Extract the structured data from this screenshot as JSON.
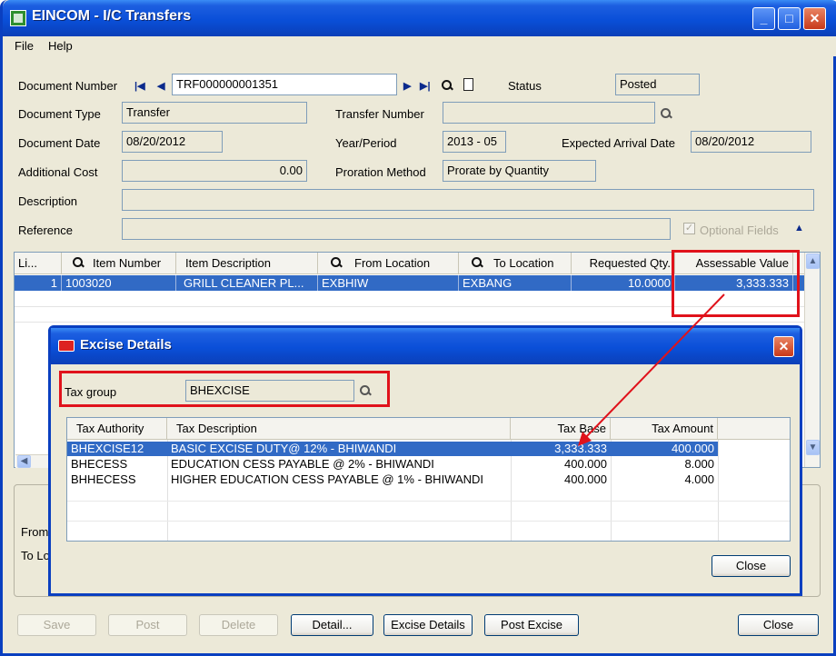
{
  "window": {
    "title": "EINCOM - I/C Transfers"
  },
  "menu": {
    "file": "File",
    "help": "Help"
  },
  "header": {
    "document_number_label": "Document Number",
    "document_number_value": "TRF000000001351",
    "status_label": "Status",
    "status_value": "Posted",
    "document_type_label": "Document Type",
    "document_type_value": "Transfer",
    "transfer_number_label": "Transfer Number",
    "transfer_number_value": "",
    "document_date_label": "Document Date",
    "document_date_value": "08/20/2012",
    "year_period_label": "Year/Period",
    "year_period_value": "2013 - 05",
    "expected_arrival_label": "Expected Arrival Date",
    "expected_arrival_value": "08/20/2012",
    "additional_cost_label": "Additional Cost",
    "additional_cost_value": "0.00",
    "proration_label": "Proration Method",
    "proration_value": "Prorate by Quantity",
    "description_label": "Description",
    "description_value": "",
    "reference_label": "Reference",
    "reference_value": "",
    "optional_fields_label": "Optional Fields"
  },
  "grid": {
    "columns": [
      "Li...",
      "Item Number",
      "Item Description",
      "From Location",
      "To Location",
      "Requested Qty.",
      "Assessable Value"
    ],
    "rows": [
      {
        "line": "1",
        "item_number": "1003020",
        "item_description": "GRILL CLEANER PL...",
        "from_location": "EXBHIW",
        "to_location": "EXBANG",
        "requested_qty": "10.0000",
        "assessable_value": "3,333.333"
      }
    ]
  },
  "lower_panel": {
    "from_label": "From",
    "to_label": "To Lo"
  },
  "buttons": {
    "save": "Save",
    "post": "Post",
    "delete": "Delete",
    "detail": "Detail...",
    "excise_details": "Excise Details",
    "post_excise": "Post Excise",
    "close": "Close"
  },
  "dialog": {
    "title": "Excise Details",
    "tax_group_label": "Tax group",
    "tax_group_value": "BHEXCISE",
    "columns": [
      "Tax Authority",
      "Tax Description",
      "Tax Base",
      "Tax Amount"
    ],
    "rows": [
      {
        "authority": "BHEXCISE12",
        "description": "BASIC EXCISE DUTY@ 12% - BHIWANDI",
        "base": "3,333.333",
        "amount": "400.000"
      },
      {
        "authority": "BHECESS",
        "description": "EDUCATION CESS PAYABLE @ 2% - BHIWANDI",
        "base": "400.000",
        "amount": "8.000"
      },
      {
        "authority": "BHHECESS",
        "description": "HIGHER EDUCATION CESS PAYABLE @ 1% - BHIWANDI",
        "base": "400.000",
        "amount": "4.000"
      }
    ],
    "close": "Close"
  },
  "colors": {
    "titlebar": "#0a4fd8",
    "selection": "#316ac5",
    "highlight": "#e0121b"
  }
}
